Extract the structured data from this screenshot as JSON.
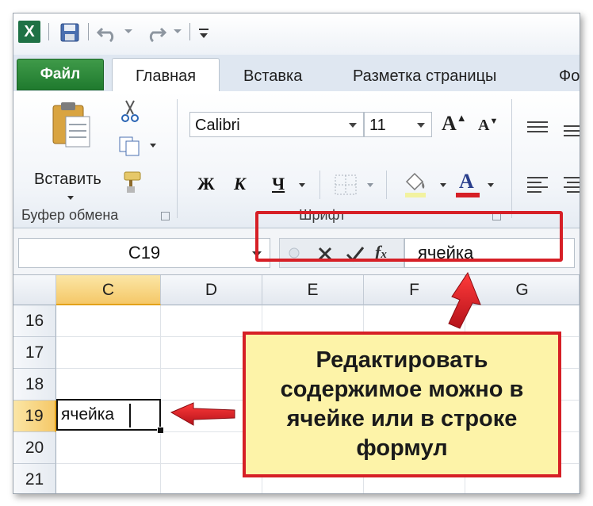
{
  "app": {
    "name": "Microsoft Excel"
  },
  "tabs": [
    {
      "label": "Файл",
      "active": false
    },
    {
      "label": "Главная",
      "active": true
    },
    {
      "label": "Вставка",
      "active": false
    },
    {
      "label": "Разметка страницы",
      "active": false
    },
    {
      "label": "Фо",
      "active": false
    }
  ],
  "ribbon": {
    "clipboard": {
      "paste_label": "Вставить",
      "group_label": "Буфер обмена"
    },
    "font": {
      "family": "Calibri",
      "size": "11",
      "bold": "Ж",
      "italic": "К",
      "underline": "Ч",
      "group_label": "Шрифт"
    }
  },
  "formula_bar": {
    "name_box": "C19",
    "content": "ячейка"
  },
  "grid": {
    "columns": [
      "C",
      "D",
      "E",
      "F",
      "G"
    ],
    "rows": [
      "16",
      "17",
      "18",
      "19",
      "20",
      "21"
    ],
    "active_column": "C",
    "active_row": "19",
    "active_cell_value": "ячейка"
  },
  "callout": {
    "text": "Редактировать\nсодержимое можно в\nячейке или в строке\nформул"
  },
  "colors": {
    "accent_red": "#d61f26",
    "callout_bg": "#fdf3a8",
    "file_tab_green": "#2d8a3a",
    "selection_gold": "#f5c868"
  },
  "icons": [
    "excel-logo-icon",
    "save-icon",
    "undo-icon",
    "redo-icon",
    "customize-qat-icon",
    "paste-icon",
    "cut-icon",
    "copy-icon",
    "format-painter-icon",
    "grow-font-icon",
    "shrink-font-icon",
    "borders-icon",
    "fill-color-icon",
    "font-color-icon",
    "align-top-icon",
    "align-left-icon",
    "cancel-icon",
    "enter-icon",
    "insert-function-icon"
  ]
}
